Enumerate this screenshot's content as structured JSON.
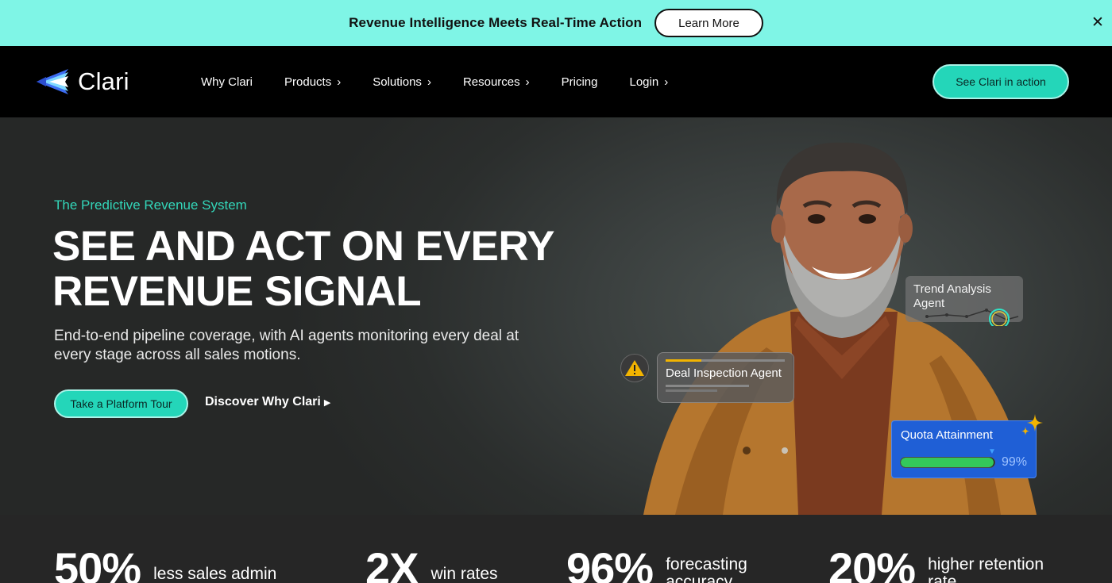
{
  "announcement": {
    "text": "Revenue Intelligence Meets Real-Time Action",
    "button": "Learn More",
    "close_icon": "close-icon"
  },
  "nav": {
    "logo_text": "Clari",
    "items": [
      {
        "label": "Why Clari",
        "has_chevron": false
      },
      {
        "label": "Products",
        "has_chevron": true
      },
      {
        "label": "Solutions",
        "has_chevron": true
      },
      {
        "label": "Resources",
        "has_chevron": true
      },
      {
        "label": "Pricing",
        "has_chevron": false
      },
      {
        "label": "Login",
        "has_chevron": true
      }
    ],
    "cta": "See Clari in action"
  },
  "hero": {
    "eyebrow": "The Predictive Revenue System",
    "headline_line1": "SEE AND ACT ON EVERY",
    "headline_line2": "REVENUE SIGNAL",
    "subhead": "End-to-end pipeline coverage, with AI agents monitoring every deal at every stage across all sales motions.",
    "primary_button": "Take a Platform Tour",
    "secondary_link": "Discover Why Clari"
  },
  "cards": {
    "trend": "Trend Analysis Agent",
    "deal": "Deal Inspection Agent",
    "quota": {
      "label": "Quota Attainment",
      "percent": "99%",
      "fill_fraction": 0.99
    }
  },
  "stats": [
    {
      "value": "50%",
      "label": "less sales admin"
    },
    {
      "value": "2X",
      "label": "win rates"
    },
    {
      "value": "96%",
      "label": "forecasting accuracy"
    },
    {
      "value": "20%",
      "label": "higher retention rate"
    }
  ],
  "colors": {
    "announcement_bg": "#7ff5e6",
    "accent": "#24d6b9",
    "eyebrow": "#33d6b9",
    "quota_card": "#1f5fd6"
  }
}
